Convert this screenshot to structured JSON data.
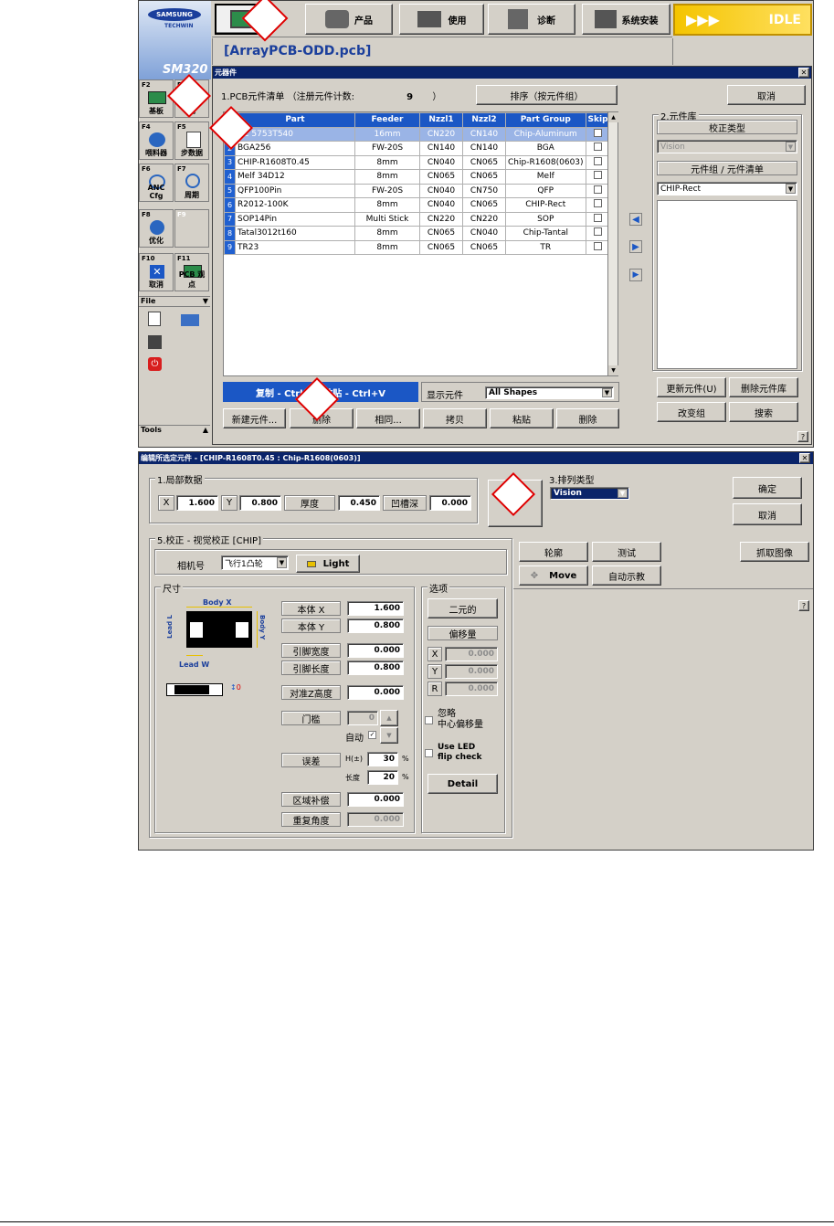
{
  "colors": {
    "accent_blue": "#1b57c5",
    "idle_yellow": "#f5d31a",
    "title_blue": "#0a246a",
    "dialog_bg": "#d4d0c8",
    "sidebar_blue": "#4a78b8",
    "callout_red": "#dd0000"
  },
  "top_bar": {
    "logo_line1": "SAMSUNG",
    "logo_line2": "TECHWIN",
    "model": "SM320",
    "file_title": "[ArrayPCB-ODD.pcb]",
    "menu": [
      {
        "label": "",
        "icon": "pcb-view-icon"
      },
      {
        "label": "产品",
        "icon": "gear-products-icon"
      },
      {
        "label": "使用",
        "icon": "truck-icon"
      },
      {
        "label": "诊断",
        "icon": "robot-diagnose-icon"
      },
      {
        "label": "系统安装",
        "icon": "system-setup-icon"
      }
    ],
    "status": "IDLE"
  },
  "sidebar": {
    "function_keys": [
      {
        "key": "F2",
        "label": "基板",
        "icon": "board-icon"
      },
      {
        "key": "F3",
        "label": "元",
        "icon": "component-icon"
      },
      {
        "key": "F4",
        "label": "喂料器",
        "icon": "feeder-icon"
      },
      {
        "key": "F5",
        "label": "步数据",
        "icon": "step-data-icon"
      },
      {
        "key": "F6",
        "label": "ANC Cfg",
        "icon": "anc-icon"
      },
      {
        "key": "F7",
        "label": "周期",
        "icon": "cycle-icon"
      },
      {
        "key": "F8",
        "label": "优化",
        "icon": "optimize-icon"
      },
      {
        "key": "F9",
        "label": "",
        "icon": ""
      },
      {
        "key": "F10",
        "label": "取消",
        "icon": "cancel-icon"
      },
      {
        "key": "F11",
        "label": "PCB 观点",
        "icon": "pcb-view-icon"
      }
    ],
    "file_section": "File",
    "tools_section": "Tools"
  },
  "components_window": {
    "title": "元器件",
    "pcb_list_label": "1.PCB元件清单 （注册元件计数:",
    "part_count": "9",
    "count_suffix": "）",
    "sort_button": "排序（按元件组）",
    "cancel_button": "取消",
    "table": {
      "columns": [
        "Part",
        "Feeder",
        "Nzzl1",
        "Nzzl2",
        "Part Group",
        "Skip"
      ],
      "rows": [
        {
          "num": "1",
          "part": "CC 5753T540",
          "feeder": "16mm",
          "nz1": "CN220",
          "nz2": "CN140",
          "group": "Chip-Aluminum"
        },
        {
          "num": "2",
          "part": "BGA256",
          "feeder": "FW-20S",
          "nz1": "CN140",
          "nz2": "CN140",
          "group": "BGA"
        },
        {
          "num": "3",
          "part": "CHIP-R1608T0.45",
          "feeder": "8mm",
          "nz1": "CN040",
          "nz2": "CN065",
          "group": "Chip-R1608(0603)"
        },
        {
          "num": "4",
          "part": "Melf 34D12",
          "feeder": "8mm",
          "nz1": "CN065",
          "nz2": "CN065",
          "group": "Melf"
        },
        {
          "num": "5",
          "part": "QFP100Pin",
          "feeder": "FW-20S",
          "nz1": "CN040",
          "nz2": "CN750",
          "group": "QFP"
        },
        {
          "num": "6",
          "part": "R2012-100K",
          "feeder": "8mm",
          "nz1": "CN040",
          "nz2": "CN065",
          "group": "CHIP-Rect"
        },
        {
          "num": "7",
          "part": "SOP14Pin",
          "feeder": "Multi Stick",
          "nz1": "CN220",
          "nz2": "CN220",
          "group": "SOP"
        },
        {
          "num": "8",
          "part": "Tatal3012t160",
          "feeder": "8mm",
          "nz1": "CN065",
          "nz2": "CN040",
          "group": "Chip-Tantal"
        },
        {
          "num": "9",
          "part": "TR23",
          "feeder": "8mm",
          "nz1": "CN065",
          "nz2": "CN065",
          "group": "TR"
        }
      ]
    },
    "copy_paste_bar": "复制 - Ctrl+C  粘贴 - Ctrl+V",
    "display_label": "显示元件",
    "display_value": "All Shapes",
    "bottom_buttons": [
      "新建元件...",
      "删除",
      "相同...",
      "拷贝",
      "粘贴",
      "删除"
    ],
    "library": {
      "title": "2.元件库",
      "correction_type_label": "校正类型",
      "correction_type_value": "Vision",
      "group_list_label": "元件组 / 元件清单",
      "group_value": "CHIP-Rect",
      "buttons": [
        "更新元件(U)",
        "删除元件库",
        "改变组",
        "搜索"
      ]
    },
    "help": "?"
  },
  "edit_window": {
    "title": "编辑所选定元件 - [CHIP-R1608T0.45 : Chip-R1608(0603)]",
    "local_data": {
      "title": "1.局部数据",
      "x_label": "X",
      "x_value": "1.600",
      "y_label": "Y",
      "y_value": "0.800",
      "thickness_label": "厚度",
      "thickness_value": "0.450",
      "pocket_label": "凹槽深",
      "pocket_value": "0.000"
    },
    "array_type": {
      "title": "3.排列类型",
      "value": "Vision"
    },
    "ok_button": "确定",
    "cancel_button": "取消",
    "alignment": {
      "title": "5.校正 - 视觉校正 [CHIP]",
      "camera_label": "相机号",
      "camera_value": "飞行1凸轮",
      "light_button": "Light",
      "size_title": "尺寸",
      "diagram": {
        "body_x": "Body X",
        "body_y": "Body Y",
        "lead_l": "Lead L",
        "lead_w": "Lead W"
      },
      "body_x_label": "本体 X",
      "body_x_value": "1.600",
      "body_y_label": "本体 Y",
      "body_y_value": "0.800",
      "lead_width_label": "引脚宽度",
      "lead_width_value": "0.000",
      "lead_length_label": "引脚长度",
      "lead_length_value": "0.800",
      "z_height_label": "对准Z高度",
      "z_height_value": "0.000",
      "threshold_label": "门槛",
      "threshold_value": "0",
      "auto_label": "自动",
      "tolerance_label": "误差",
      "h_label": "H(±)",
      "h_value": "30",
      "h_unit": "%",
      "len_label": "长度",
      "len_value": "20",
      "len_unit": "%",
      "region_label": "区域补偿",
      "region_value": "0.000",
      "repeat_angle_label": "重复角度",
      "repeat_angle_value": "0.000"
    },
    "options": {
      "title": "选项",
      "binary_button": "二元的",
      "offset_label": "偏移量",
      "ox_label": "X",
      "ox_value": "0.000",
      "oy_label": "Y",
      "oy_value": "0.000",
      "or_label": "R",
      "or_value": "0.000",
      "ignore_center_label": "忽略\n中心偏移量",
      "use_led_label": "Use LED\nflip check",
      "detail_button": "Detail"
    },
    "right_buttons": [
      "轮廓",
      "测试",
      "抓取图像",
      "Move",
      "自动示教"
    ],
    "help": "?"
  }
}
